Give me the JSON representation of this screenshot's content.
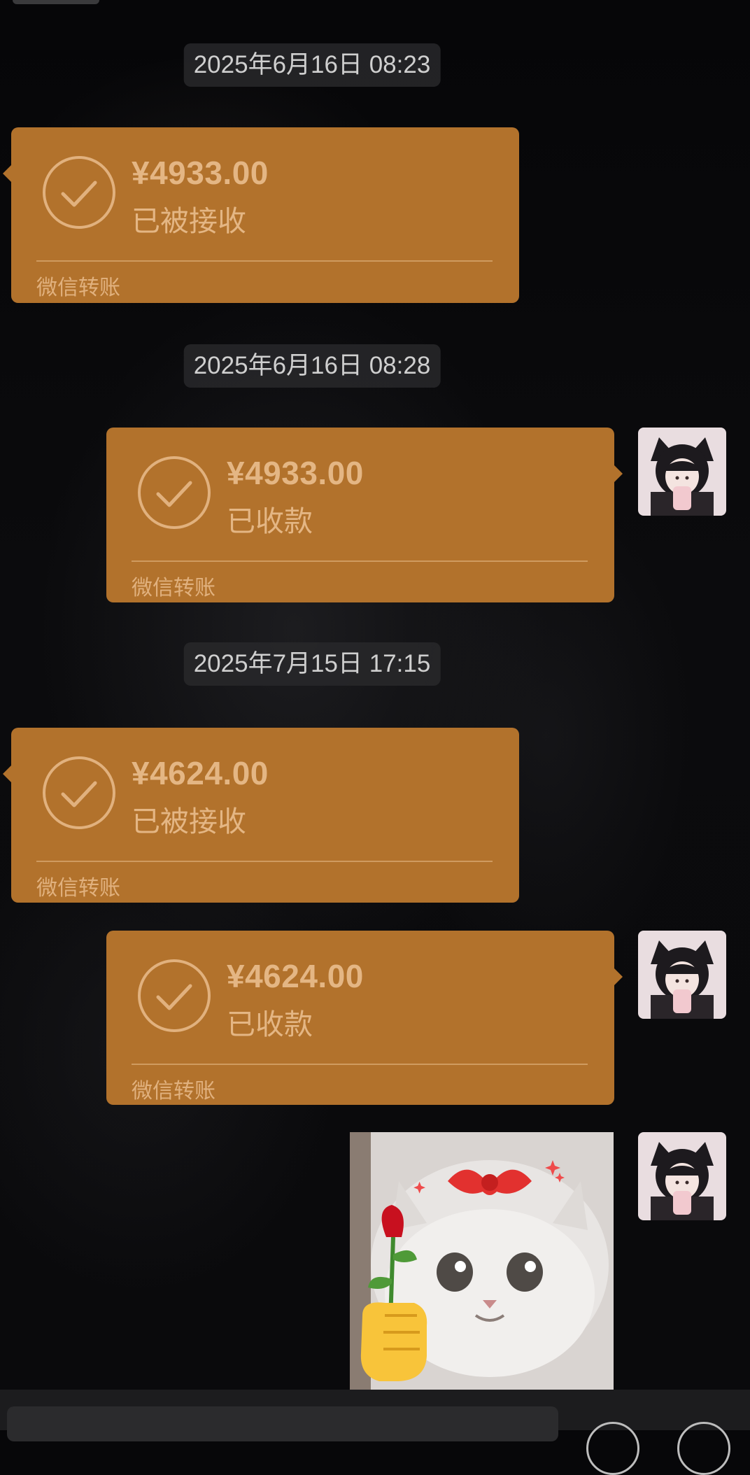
{
  "timestamps": [
    "2025年6月16日 08:23",
    "2025年6月16日 08:28",
    "2025年7月15日 17:15"
  ],
  "messages": [
    {
      "amount": "¥4933.00",
      "status": "已被接收",
      "footer": "微信转账",
      "side": "left"
    },
    {
      "amount": "¥4933.00",
      "status": "已收款",
      "footer": "微信转账",
      "side": "right"
    },
    {
      "amount": "¥4624.00",
      "status": "已被接收",
      "footer": "微信转账",
      "side": "left"
    },
    {
      "amount": "¥4624.00",
      "status": "已收款",
      "footer": "微信转账",
      "side": "right"
    }
  ],
  "icons": {
    "check": "check-circle-icon",
    "avatar": "avatar",
    "sticker": "cat-rose-sticker",
    "voice": "voice-icon",
    "emoji": "emoji-icon"
  },
  "colors": {
    "bubble": "#b2722c",
    "bubble_text": "#e4b684",
    "timestamp_bg": "#28282a",
    "timestamp_text": "#cfcfcf"
  }
}
